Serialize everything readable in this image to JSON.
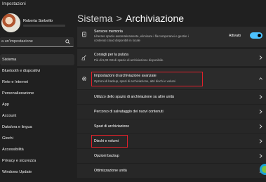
{
  "window": {
    "title": "Impostazioni"
  },
  "user": {
    "name": "Roberta Sorbello"
  },
  "search": {
    "placeholder": "a un'impostazione"
  },
  "sidebar": {
    "items": [
      {
        "label": "Sistema",
        "selected": true
      },
      {
        "label": "Bluetooth e dispositivi"
      },
      {
        "label": "Rete e Internet"
      },
      {
        "label": "Personalizzazione"
      },
      {
        "label": "App"
      },
      {
        "label": "Account"
      },
      {
        "label": "Data/ora e lingua"
      },
      {
        "label": "Giochi"
      },
      {
        "label": "Accessibilità"
      },
      {
        "label": "Privacy e sicurezza"
      },
      {
        "label": "Windows Update"
      }
    ]
  },
  "header": {
    "parent": "Sistema",
    "separator": ">",
    "title": "Archiviazione"
  },
  "storage_sense": {
    "title": "Sensore memoria",
    "desc1": "Liberare spazio automaticamente, eliminare i file temporanei e gestire i",
    "desc2": "contenuti cloud disponibili in locale",
    "toggle_label": "Attivato",
    "toggle_on": true
  },
  "cleanup": {
    "title": "Consigli per la pulizia",
    "desc": "Più di 5,00 GB di spazio di archiviazione disponibile."
  },
  "advanced": {
    "title": "Impostazioni di archiviazione avanzate",
    "desc": "Opzioni di backup, spazi di archiviazione, altri dischi e volumi"
  },
  "advanced_items": [
    {
      "label": "Utilizzo dello spazio di archiviazione su altre unità"
    },
    {
      "label": "Percorso di salvataggio dei nuovi contenuti"
    },
    {
      "label": "Spazi di archiviazione"
    },
    {
      "label": "Dischi e volumi"
    },
    {
      "label": "Opzioni backup"
    },
    {
      "label": "Ottimizzazione unità"
    }
  ],
  "colors": {
    "accent": "#4cc2ff",
    "highlight": "#e0202a",
    "background": "#202020"
  }
}
